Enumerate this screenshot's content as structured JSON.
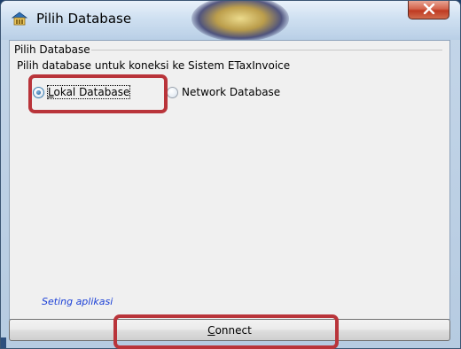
{
  "window": {
    "title": "Pilih Database",
    "icon": "database-app-icon",
    "close_icon": "close-icon"
  },
  "group": {
    "label": "Pilih Database",
    "instruction": "Pilih database untuk koneksi ke Sistem ETaxInvoice"
  },
  "options": [
    {
      "label": "Lokal Database",
      "checked": true
    },
    {
      "label": "Network Database",
      "checked": false
    }
  ],
  "settings_link": "Seting aplikasi",
  "connect_label": "Connect",
  "colors": {
    "highlight": "#b9343a",
    "link": "#1a3fd6",
    "close_button": "#c8452c"
  }
}
